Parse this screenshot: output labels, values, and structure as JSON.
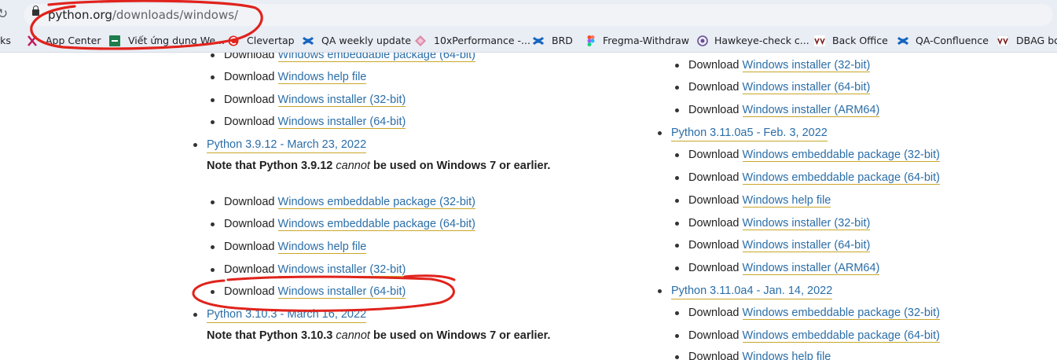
{
  "browser": {
    "url_host": "python.org",
    "url_path": "/downloads/windows/"
  },
  "bookmarks": [
    {
      "label": "rks",
      "icon": "none"
    },
    {
      "label": "App Center",
      "icon": "app-center-icon"
    },
    {
      "label": "Viết ứng dụng We...",
      "icon": "green-square-icon"
    },
    {
      "label": "Clevertap",
      "icon": "clevertap-icon"
    },
    {
      "label": "QA weekly update",
      "icon": "confluence-icon"
    },
    {
      "label": "10xPerformance -...",
      "icon": "diamond-icon"
    },
    {
      "label": "BRD",
      "icon": "confluence-icon"
    },
    {
      "label": "Fregma-Withdraw",
      "icon": "figma-icon"
    },
    {
      "label": "Hawkeye-check c...",
      "icon": "eye-icon"
    },
    {
      "label": "Back Office",
      "icon": "vv-icon"
    },
    {
      "label": "QA-Confluence",
      "icon": "confluence-icon"
    },
    {
      "label": "DBAG bo",
      "icon": "vv-icon"
    }
  ],
  "page": {
    "download_word": "Download",
    "note_prefix": "Note that Python",
    "note_cannot": "cannot",
    "note_suffix": "be used on Windows 7 or earlier.",
    "left_column": {
      "top_items": [
        "Windows embeddable package (64-bit)",
        "Windows help file",
        "Windows installer (32-bit)",
        "Windows installer (64-bit)"
      ],
      "release_1": {
        "title": "Python 3.9.12 - March 23, 2022",
        "note_version": "3.9.12",
        "items": [
          "Windows embeddable package (32-bit)",
          "Windows embeddable package (64-bit)",
          "Windows help file",
          "Windows installer (32-bit)",
          "Windows installer (64-bit)"
        ]
      },
      "release_2": {
        "title": "Python 3.10.3 - March 16, 2022",
        "note_version": "3.10.3"
      }
    },
    "right_column": {
      "top_items": [
        "Windows installer (32-bit)",
        "Windows installer (64-bit)",
        "Windows installer (ARM64)"
      ],
      "release_1": {
        "title": "Python 3.11.0a5 - Feb. 3, 2022",
        "items": [
          "Windows embeddable package (32-bit)",
          "Windows embeddable package (64-bit)",
          "Windows help file",
          "Windows installer (32-bit)",
          "Windows installer (64-bit)",
          "Windows installer (ARM64)"
        ]
      },
      "release_2": {
        "title": "Python 3.11.0a4 - Jan. 14, 2022",
        "items": [
          "Windows embeddable package (32-bit)",
          "Windows embeddable package (64-bit)",
          "Windows help file"
        ]
      }
    }
  },
  "colors": {
    "link": "#2b6ea8",
    "link_underline": "#c8a72a",
    "annotation": "#e0231c"
  }
}
